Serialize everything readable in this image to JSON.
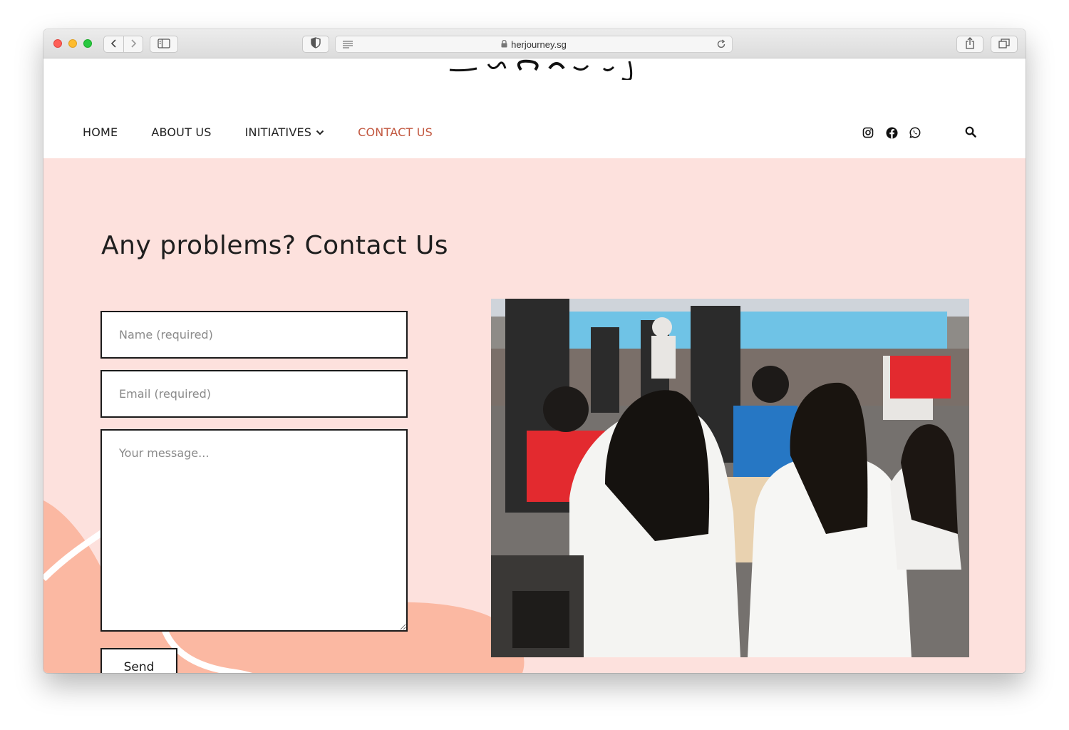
{
  "browser": {
    "url": "herjourney.sg",
    "icons": [
      "back-icon",
      "forward-icon",
      "sidebar-icon",
      "shield-icon",
      "reader-icon",
      "lock-icon",
      "reload-icon",
      "share-icon",
      "tabs-icon"
    ]
  },
  "nav": {
    "home": "HOME",
    "about": "ABOUT US",
    "initiatives": "INITIATIVES",
    "contact": "CONTACT US"
  },
  "social_icons": [
    "instagram-icon",
    "facebook-icon",
    "whatsapp-icon"
  ],
  "contact": {
    "title": "Any problems? Contact Us",
    "name_placeholder": "Name (required)",
    "email_placeholder": "Email (required)",
    "message_placeholder": "Your message...",
    "send_label": "Send"
  },
  "colors": {
    "accent": "#c2573f",
    "page_background": "#fde1dd",
    "blob": "#fbb8a2"
  }
}
